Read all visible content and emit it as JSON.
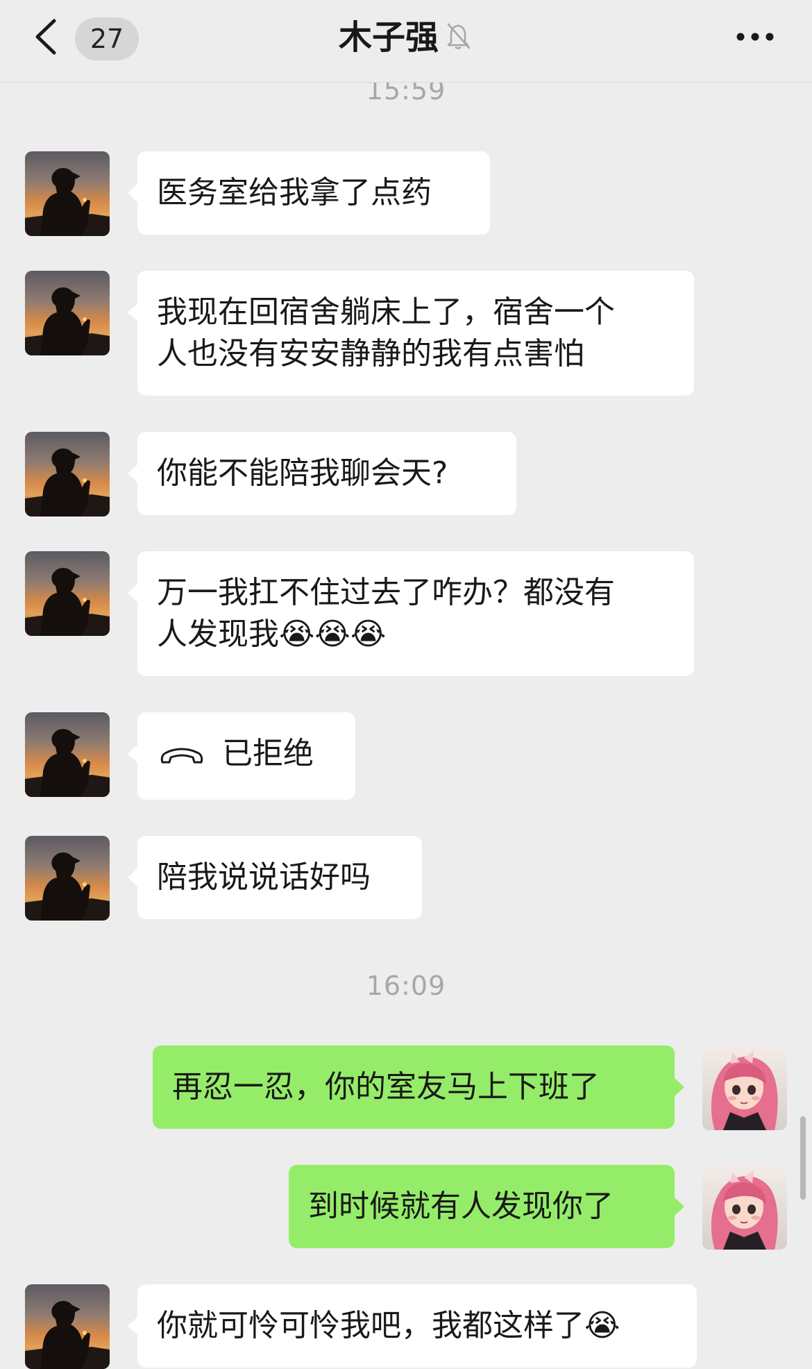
{
  "header": {
    "unread_count": "27",
    "title": "木子强",
    "back_icon": "chevron-left-icon",
    "mute_icon": "bell-off-icon",
    "more_icon": "ellipsis-icon"
  },
  "times": [
    "15:59",
    "16:09"
  ],
  "messages": [
    {
      "side": "in",
      "text": "医务室给我拿了点药"
    },
    {
      "side": "in",
      "line1": "我现在回宿舍躺床上了，宿舍一个",
      "line2": "人也没有安安静静的我有点害怕"
    },
    {
      "side": "in",
      "text": "你能不能陪我聊会天?"
    },
    {
      "side": "in",
      "line1": "万一我扛不住过去了咋办？都没有",
      "line2": "人发现我",
      "emoji": "😭😭😭"
    },
    {
      "side": "in",
      "type": "call",
      "text": "已拒绝",
      "icon": "phone-hangup-icon"
    },
    {
      "side": "in",
      "text": "陪我说说话好吗"
    },
    {
      "side": "out",
      "text": "再忍一忍，你的室友马上下班了"
    },
    {
      "side": "out",
      "text": "到时候就有人发现你了"
    },
    {
      "side": "in",
      "text": "你就可怜可怜我吧，我都这样了",
      "emoji": "😭"
    }
  ],
  "colors": {
    "background": "#ededed",
    "incoming_bubble": "#ffffff",
    "outgoing_bubble": "#95ec69",
    "timestamp": "#a7a7a7"
  }
}
